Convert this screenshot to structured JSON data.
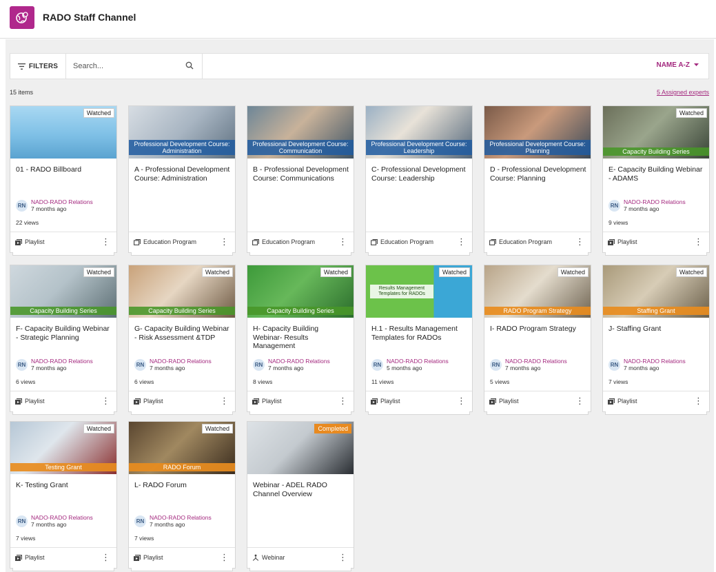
{
  "header": {
    "title": "RADO Staff Channel",
    "logo_icon": "globe-settings-icon"
  },
  "toolbar": {
    "filters_label": "FILTERS",
    "search_placeholder": "Search...",
    "sort_label": "NAME A-Z"
  },
  "count_label": "15 items",
  "experts_link": "5 Assigned experts",
  "colors": {
    "brand": "#b0288c",
    "accent": "#a3287e"
  },
  "cards": [
    {
      "title": "01 - RADO Billboard",
      "badge": "Watched",
      "banner": "",
      "author": "NADO-RADO Relations",
      "initials": "RN",
      "time": "7 months ago",
      "views": "22 views",
      "type": "Playlist",
      "thumb": "billboard"
    },
    {
      "title": "A - Professional Development Course: Administration",
      "badge": "",
      "banner": "Professional Development Course: Administration",
      "author": "",
      "initials": "",
      "time": "",
      "views": "",
      "type": "Education Program",
      "thumb": "pd-admin"
    },
    {
      "title": "B - Professional Development Course: Communications",
      "badge": "",
      "banner": "Professional Development Course: Communication",
      "author": "",
      "initials": "",
      "time": "",
      "views": "",
      "type": "Education Program",
      "thumb": "pd-comm"
    },
    {
      "title": "C- Professional Development Course: Leadership",
      "badge": "",
      "banner": "Professional Development Course: Leadership",
      "author": "",
      "initials": "",
      "time": "",
      "views": "",
      "type": "Education Program",
      "thumb": "pd-lead"
    },
    {
      "title": "D - Professional Development Course: Planning",
      "badge": "",
      "banner": "Professional Development Course: Planning",
      "author": "",
      "initials": "",
      "time": "",
      "views": "",
      "type": "Education Program",
      "thumb": "pd-plan"
    },
    {
      "title": "E- Capacity Building Webinar - ADAMS",
      "badge": "Watched",
      "banner": "Capacity Building Series",
      "author": "NADO-RADO Relations",
      "initials": "RN",
      "time": "7 months ago",
      "views": "9 views",
      "type": "Playlist",
      "thumb": "cb-laptop"
    },
    {
      "title": "F- Capacity Building Webinar - Strategic Planning",
      "badge": "Watched",
      "banner": "Capacity Building Series",
      "author": "NADO-RADO Relations",
      "initials": "RN",
      "time": "7 months ago",
      "views": "6 views",
      "type": "Playlist",
      "thumb": "cb-strategic"
    },
    {
      "title": "G- Capacity Building Webinar - Risk Assessment &TDP",
      "badge": "Watched",
      "banner": "Capacity Building Series",
      "author": "NADO-RADO Relations",
      "initials": "RN",
      "time": "7 months ago",
      "views": "6 views",
      "type": "Playlist",
      "thumb": "cb-risk"
    },
    {
      "title": "H- Capacity Building Webinar- Results Management",
      "badge": "Watched",
      "banner": "Capacity Building Series",
      "author": "NADO-RADO Relations",
      "initials": "RN",
      "time": "7 months ago",
      "views": "8 views",
      "type": "Playlist",
      "thumb": "cb-results"
    },
    {
      "title": "H.1 - Results Management Templates for RADOs",
      "badge": "Watched",
      "banner": "",
      "thumb_text": "Results Management Templates for RADOs",
      "author": "NADO-RADO Relations",
      "initials": "RN",
      "time": "5 months ago",
      "views": "11 views",
      "type": "Playlist",
      "thumb": "results-templates"
    },
    {
      "title": "I- RADO Program Strategy",
      "badge": "Watched",
      "banner": "RADO Program Strategy",
      "author": "NADO-RADO Relations",
      "initials": "RN",
      "time": "7 months ago",
      "views": "5 views",
      "type": "Playlist",
      "thumb": "program-strategy"
    },
    {
      "title": "J- Staffing Grant",
      "badge": "Watched",
      "banner": "Staffing Grant",
      "author": "NADO-RADO Relations",
      "initials": "RN",
      "time": "7 months ago",
      "views": "7 views",
      "type": "Playlist",
      "thumb": "staffing"
    },
    {
      "title": "K- Testing Grant",
      "badge": "Watched",
      "banner": "Testing Grant",
      "author": "NADO-RADO Relations",
      "initials": "RN",
      "time": "7 months ago",
      "views": "7 views",
      "type": "Playlist",
      "thumb": "testing"
    },
    {
      "title": "L- RADO Forum",
      "badge": "Watched",
      "banner": "RADO Forum",
      "author": "NADO-RADO Relations",
      "initials": "RN",
      "time": "7 months ago",
      "views": "7 views",
      "type": "Playlist",
      "thumb": "forum"
    },
    {
      "title": "Webinar - ADEL RADO Channel Overview",
      "badge": "Completed",
      "banner": "",
      "author": "",
      "initials": "",
      "time": "",
      "views": "",
      "type": "Webinar",
      "thumb": "webinar"
    }
  ]
}
